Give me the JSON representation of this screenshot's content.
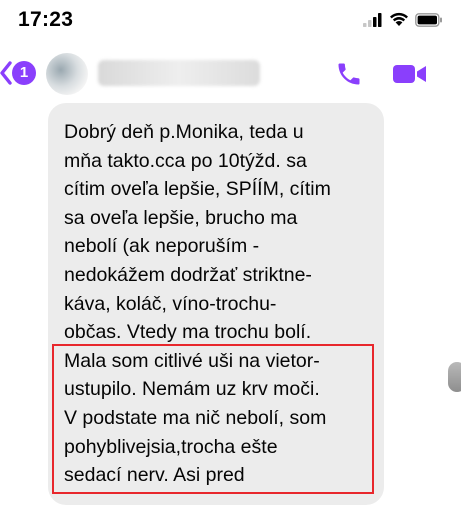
{
  "status_bar": {
    "time": "17:23"
  },
  "header": {
    "unread_count": "1",
    "contact_name": "",
    "icons": {
      "back": "chevron-left-icon",
      "call": "phone-icon",
      "video": "video-camera-icon"
    }
  },
  "colors": {
    "accent": "#8a3ffc",
    "bubble": "#ececec",
    "highlight": "#e8272c"
  },
  "message": {
    "lines": [
      "Dobrý deň p.Monika, teda u",
      "mňa takto.cca po 10týžd. sa",
      "cítim oveľa lepšie, SPÍÍM, cítim",
      "sa oveľa lepšie, brucho ma",
      "nebolí (ak neporuším -",
      "nedokážem dodržať striktne-",
      "káva, koláč, víno-trochu-",
      "občas. Vtedy ma trochu bolí.",
      "Mala som citlivé uši na vietor-",
      "ustupilo. Nemám uz krv moči.",
      "V podstate ma nič nebolí, som",
      "pohyblivejsia,trocha ešte",
      "sedací nerv. Asi pred"
    ]
  }
}
